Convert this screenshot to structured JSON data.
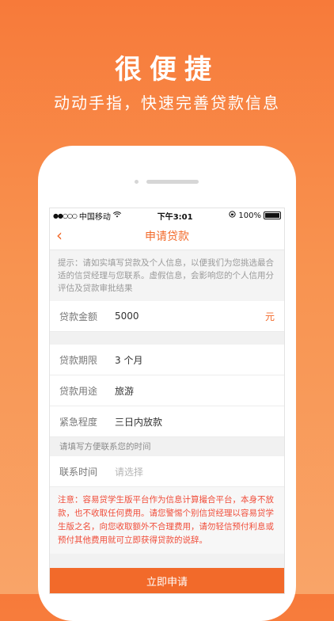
{
  "hero": {
    "title": "很便捷",
    "subtitle": "动动手指，快速完善贷款信息"
  },
  "statusbar": {
    "signal": "●●○○○",
    "carrier": "中国移动",
    "wifi_icon": "wifi-icon",
    "time": "下午3:01",
    "lock_icon": "rotation-lock-icon",
    "battery": "100%"
  },
  "navbar": {
    "back_icon": "‹",
    "title": "申请贷款"
  },
  "tip": "提示：请如实填写贷款及个人信息，以便我们为您挑选最合适的信贷经理与您联系。虚假信息，会影响您的个人信用分评估及贷款审批结果",
  "form": {
    "amount": {
      "label": "贷款金额",
      "value": "5000",
      "unit": "元"
    },
    "term": {
      "label": "贷款期限",
      "value": "3 个月"
    },
    "purpose": {
      "label": "贷款用途",
      "value": "旅游"
    },
    "urgency": {
      "label": "紧急程度",
      "value": "三日内放款"
    },
    "contact_hint": "请填写方便联系您的时间",
    "contact": {
      "label": "联系时间",
      "placeholder": "请选择"
    }
  },
  "notice": "注意：容易贷学生版平台作为信息计算撮合平台，本身不放款，也不收取任何费用。请您警惕个别信贷经理以容易贷学生版之名，向您收取额外不合理费用，请勿轻信预付利息或预付其他费用就可立即获得贷款的说辞。",
  "submit_label": "立即申请",
  "colors": {
    "accent": "#f26a2a",
    "warning": "#f04d3a"
  }
}
